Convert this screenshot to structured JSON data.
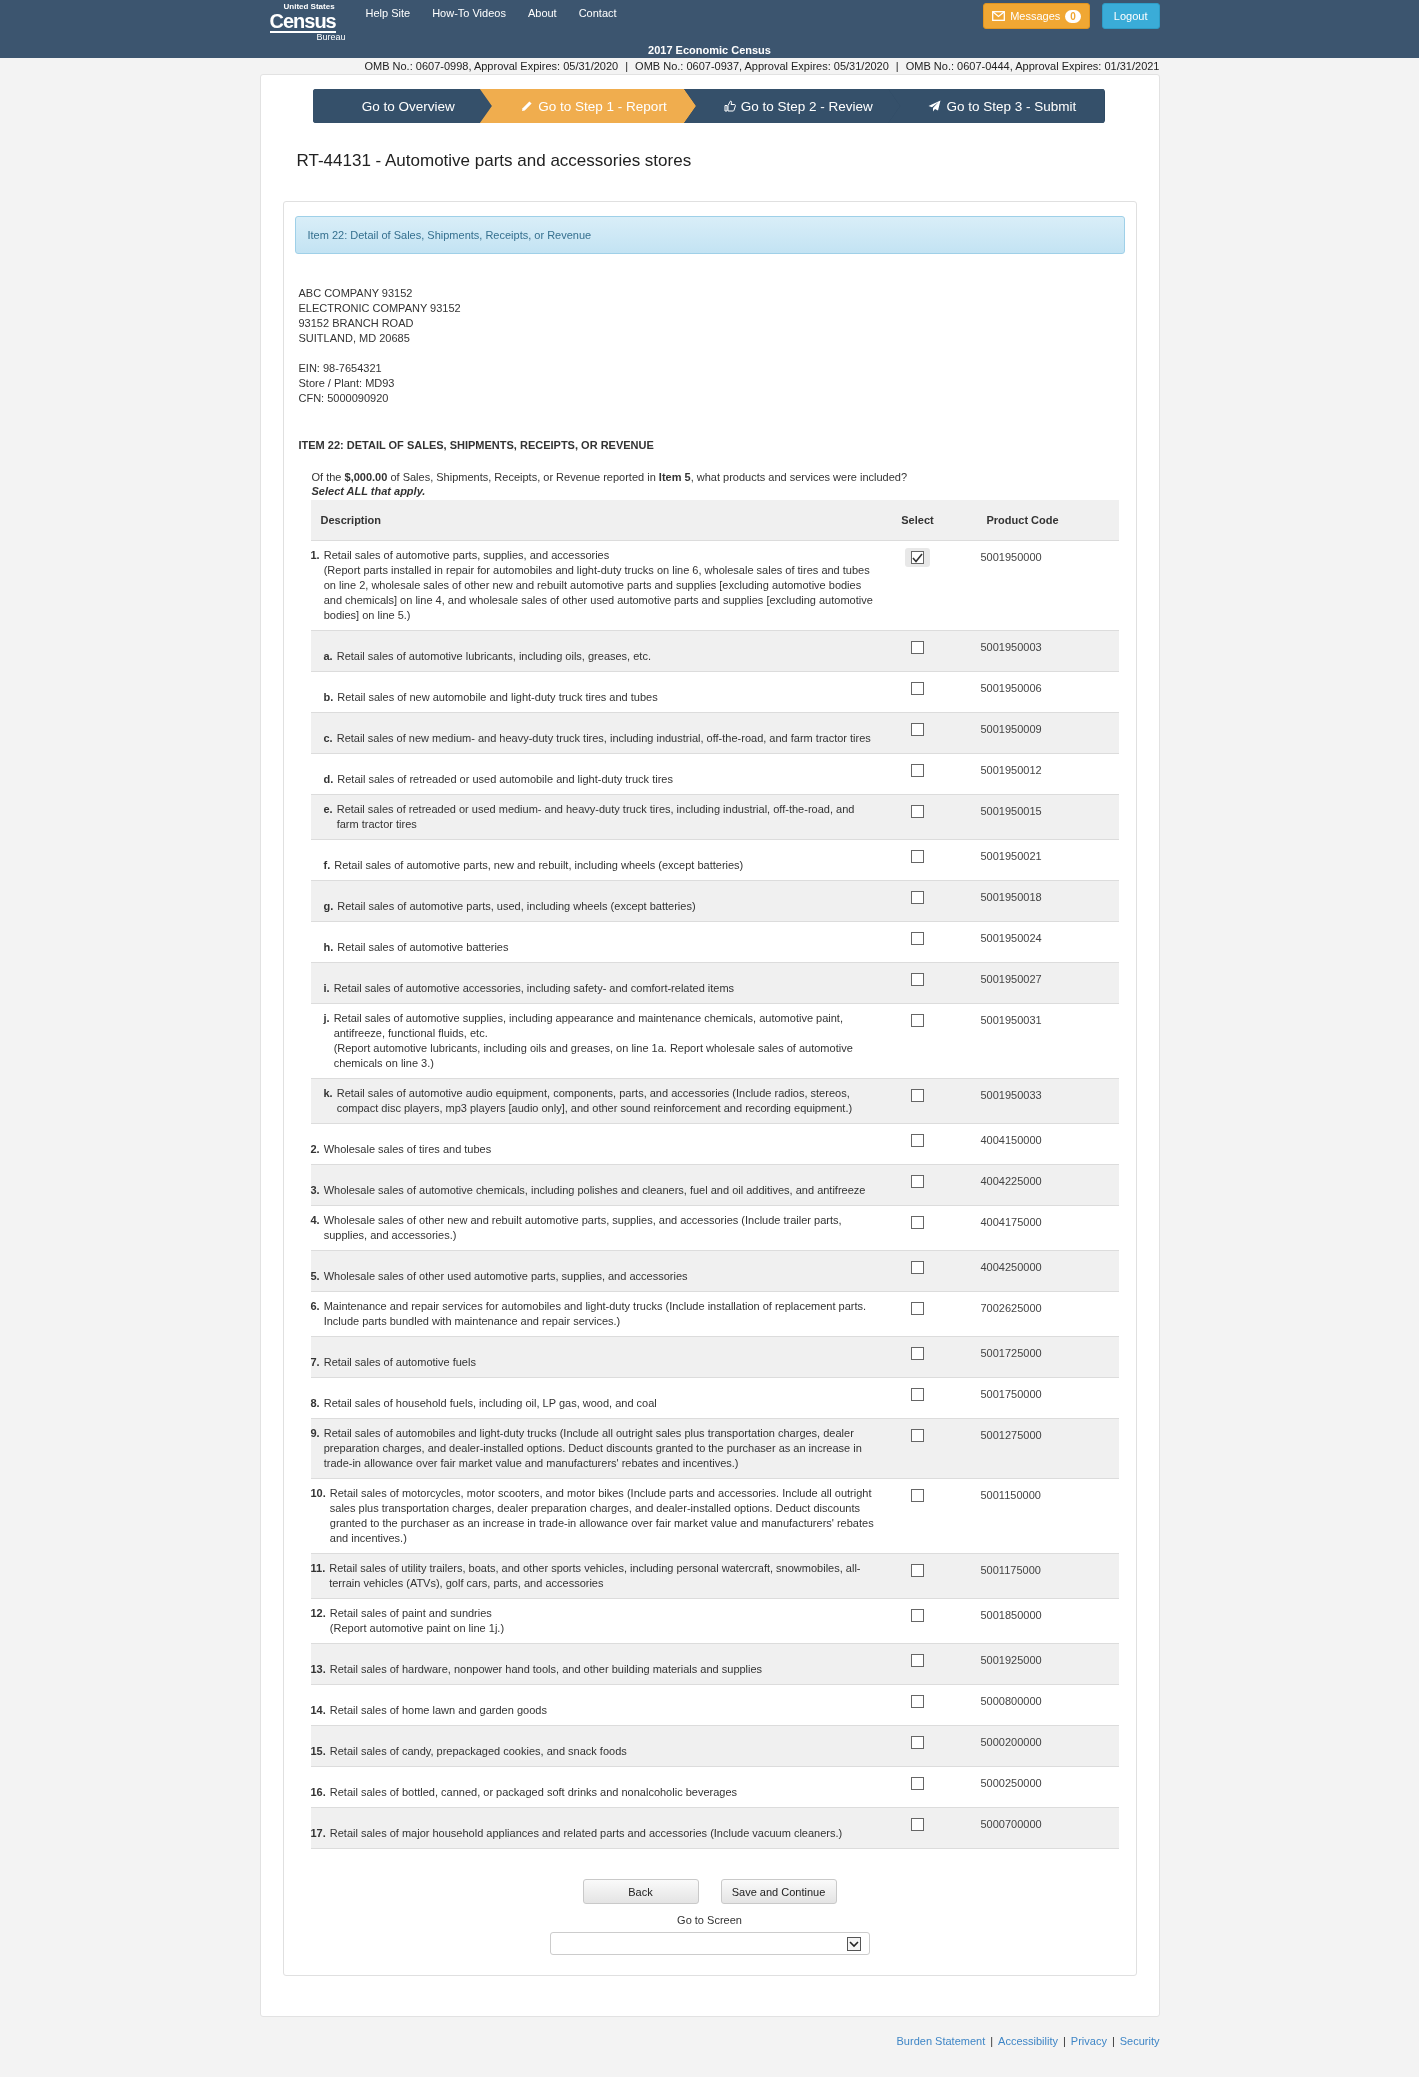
{
  "header": {
    "logo": {
      "top": "United States",
      "main": "Census",
      "bottom": "Bureau"
    },
    "nav": [
      "Help Site",
      "How-To Videos",
      "About",
      "Contact"
    ],
    "messages": {
      "label": "Messages",
      "count": "0"
    },
    "logout": "Logout",
    "subtitle": "2017 Economic Census"
  },
  "omb": [
    {
      "text": "OMB No.: 0607-0998, Approval Expires: 05/31/2020",
      "separator": "|"
    },
    {
      "text": "OMB No.: 0607-0937, Approval Expires: 05/31/2020",
      "separator": "|"
    },
    {
      "text": "OMB No.: 0607-0444, Approval Expires: 01/31/2021"
    }
  ],
  "steps": [
    {
      "label": "Go to Overview",
      "selected": false
    },
    {
      "label": "Go to Step 1 - Report",
      "selected": true
    },
    {
      "label": "Go to Step 2 - Review",
      "selected": false
    },
    {
      "label": "Go to Step 3 - Submit",
      "selected": false
    }
  ],
  "title": "RT-44131 - Automotive parts and accessories stores",
  "panel_heading": "Item 22: Detail of Sales, Shipments, Receipts, or Revenue",
  "address": [
    "ABC COMPANY 93152",
    "ELECTRONIC COMPANY 93152",
    "93152 BRANCH ROAD",
    "SUITLAND, MD 20685"
  ],
  "ids": [
    "EIN: 98-7654321",
    "Store / Plant: MD93",
    "CFN: 5000090920"
  ],
  "section_title": "ITEM 22: DETAIL OF SALES, SHIPMENTS, RECEIPTS, OR REVENUE",
  "question": "Of the **$,000.00** of Sales, Shipments, Receipts, or Revenue reported in **Item 5**, what products and services were included?",
  "instruction": "Select ALL that apply.",
  "table": {
    "columns": [
      "Description",
      "Select",
      "Product Code"
    ],
    "rows": [
      {
        "kind": "item",
        "marker": "1.",
        "text": "Retail sales of automotive parts, supplies, and accessories",
        "note": "(Report parts installed in repair for automobiles and light-duty trucks on line 6, wholesale sales of tires and tubes on line 2, wholesale sales of other new and rebuilt automotive parts and supplies [excluding automotive bodies and chemicals] on line 4, and wholesale sales of other used automotive parts and supplies [excluding automotive bodies] on line 5.)",
        "checked": true,
        "code": "5001950000"
      },
      {
        "kind": "subitem",
        "marker": "a.",
        "text": "Retail sales of automotive lubricants, including oils, greases, etc.",
        "checked": false,
        "code": "5001950003"
      },
      {
        "kind": "subitem",
        "marker": "b.",
        "text": "Retail sales of new automobile and light-duty truck tires and tubes",
        "checked": false,
        "code": "5001950006"
      },
      {
        "kind": "subitem",
        "marker": "c.",
        "text": "Retail sales of new medium- and heavy-duty truck tires, including industrial, off-the-road, and farm tractor tires",
        "checked": false,
        "code": "5001950009"
      },
      {
        "kind": "subitem",
        "marker": "d.",
        "text": "Retail sales of retreaded or used automobile and light-duty truck tires",
        "checked": false,
        "code": "5001950012"
      },
      {
        "kind": "subitem",
        "marker": "e.",
        "text": "Retail sales of retreaded or used medium- and heavy-duty truck tires, including industrial, off-the-road, and farm tractor tires",
        "checked": false,
        "code": "5001950015"
      },
      {
        "kind": "subitem",
        "marker": "f.",
        "text": "Retail sales of automotive parts, new and rebuilt, including wheels (except batteries)",
        "checked": false,
        "code": "5001950021"
      },
      {
        "kind": "subitem",
        "marker": "g.",
        "text": "Retail sales of automotive parts, used, including wheels (except batteries)",
        "checked": false,
        "code": "5001950018"
      },
      {
        "kind": "subitem",
        "marker": "h.",
        "text": "Retail sales of automotive batteries",
        "checked": false,
        "code": "5001950024"
      },
      {
        "kind": "subitem",
        "marker": "i.",
        "text": "Retail sales of automotive accessories, including safety- and comfort-related items",
        "checked": false,
        "code": "5001950027"
      },
      {
        "kind": "subitem",
        "marker": "j.",
        "text": "Retail sales of automotive supplies, including appearance and maintenance chemicals, automotive paint, antifreeze, functional fluids, etc.",
        "note": "(Report automotive lubricants, including oils and greases, on line 1a. Report wholesale sales of automotive chemicals on line 3.)",
        "checked": false,
        "code": "5001950031"
      },
      {
        "kind": "subitem",
        "marker": "k.",
        "text": "Retail sales of automotive audio equipment, components, parts, and accessories (Include radios, stereos, compact disc players, mp3 players [audio only], and other sound reinforcement and recording equipment.)",
        "checked": false,
        "code": "5001950033"
      },
      {
        "kind": "item",
        "marker": "2.",
        "text": "Wholesale sales of tires and tubes",
        "checked": false,
        "code": "4004150000"
      },
      {
        "kind": "item",
        "marker": "3.",
        "text": "Wholesale sales of automotive chemicals, including polishes and cleaners, fuel and oil additives, and antifreeze",
        "checked": false,
        "code": "4004225000"
      },
      {
        "kind": "item",
        "marker": "4.",
        "text": "Wholesale sales of other new and rebuilt automotive parts, supplies, and accessories (Include trailer parts, supplies, and accessories.)",
        "checked": false,
        "code": "4004175000"
      },
      {
        "kind": "item",
        "marker": "5.",
        "text": "Wholesale sales of other used automotive parts, supplies, and accessories",
        "checked": false,
        "code": "4004250000"
      },
      {
        "kind": "item",
        "marker": "6.",
        "text": "Maintenance and repair services for automobiles and light-duty trucks (Include installation of replacement parts. Include parts bundled with maintenance and repair services.)",
        "checked": false,
        "code": "7002625000"
      },
      {
        "kind": "item",
        "marker": "7.",
        "text": "Retail sales of automotive fuels",
        "checked": false,
        "code": "5001725000"
      },
      {
        "kind": "item",
        "marker": "8.",
        "text": "Retail sales of household fuels, including oil, LP gas, wood, and coal",
        "checked": false,
        "code": "5001750000"
      },
      {
        "kind": "item",
        "marker": "9.",
        "text": "Retail sales of automobiles and light-duty trucks (Include all outright sales plus transportation charges, dealer preparation charges, and dealer-installed options. Deduct discounts granted to the purchaser as an increase in trade-in allowance over fair market value and manufacturers' rebates and incentives.)",
        "checked": false,
        "code": "5001275000"
      },
      {
        "kind": "item",
        "marker": "10.",
        "text": "Retail sales of motorcycles, motor scooters, and motor bikes (Include parts and accessories. Include all outright sales plus transportation charges, dealer preparation charges, and dealer-installed options. Deduct discounts granted to the purchaser as an increase in trade-in allowance over fair market value and manufacturers' rebates and incentives.)",
        "checked": false,
        "code": "5001150000"
      },
      {
        "kind": "item",
        "marker": "11.",
        "text": "Retail sales of utility trailers, boats, and other sports vehicles, including personal watercraft, snowmobiles, all-terrain vehicles (ATVs), golf cars, parts, and accessories",
        "checked": false,
        "code": "5001175000"
      },
      {
        "kind": "item",
        "marker": "12.",
        "text": "Retail sales of paint and sundries",
        "note": "(Report automotive paint on line 1j.)",
        "checked": false,
        "code": "5001850000"
      },
      {
        "kind": "item",
        "marker": "13.",
        "text": "Retail sales of hardware, nonpower hand tools, and other building materials and supplies",
        "checked": false,
        "code": "5001925000"
      },
      {
        "kind": "item",
        "marker": "14.",
        "text": "Retail sales of home lawn and garden goods",
        "checked": false,
        "code": "5000800000"
      },
      {
        "kind": "item",
        "marker": "15.",
        "text": "Retail sales of candy, prepackaged cookies, and snack foods",
        "checked": false,
        "code": "5000200000"
      },
      {
        "kind": "item",
        "marker": "16.",
        "text": "Retail sales of bottled, canned, or packaged soft drinks and nonalcoholic beverages",
        "checked": false,
        "code": "5000250000"
      },
      {
        "kind": "item",
        "marker": "17.",
        "text": "Retail sales of major household appliances and related parts and accessories (Include vacuum cleaners.)",
        "checked": false,
        "code": "5000700000"
      }
    ]
  },
  "buttons": [
    "Back",
    "Save and Continue"
  ],
  "goto_label": "Go to Screen",
  "footer_links": [
    {
      "label": "Burden Statement",
      "separator": "|"
    },
    {
      "label": "Accessibility",
      "separator": "|"
    },
    {
      "label": "Privacy",
      "separator": "|"
    },
    {
      "label": "Security"
    }
  ]
}
